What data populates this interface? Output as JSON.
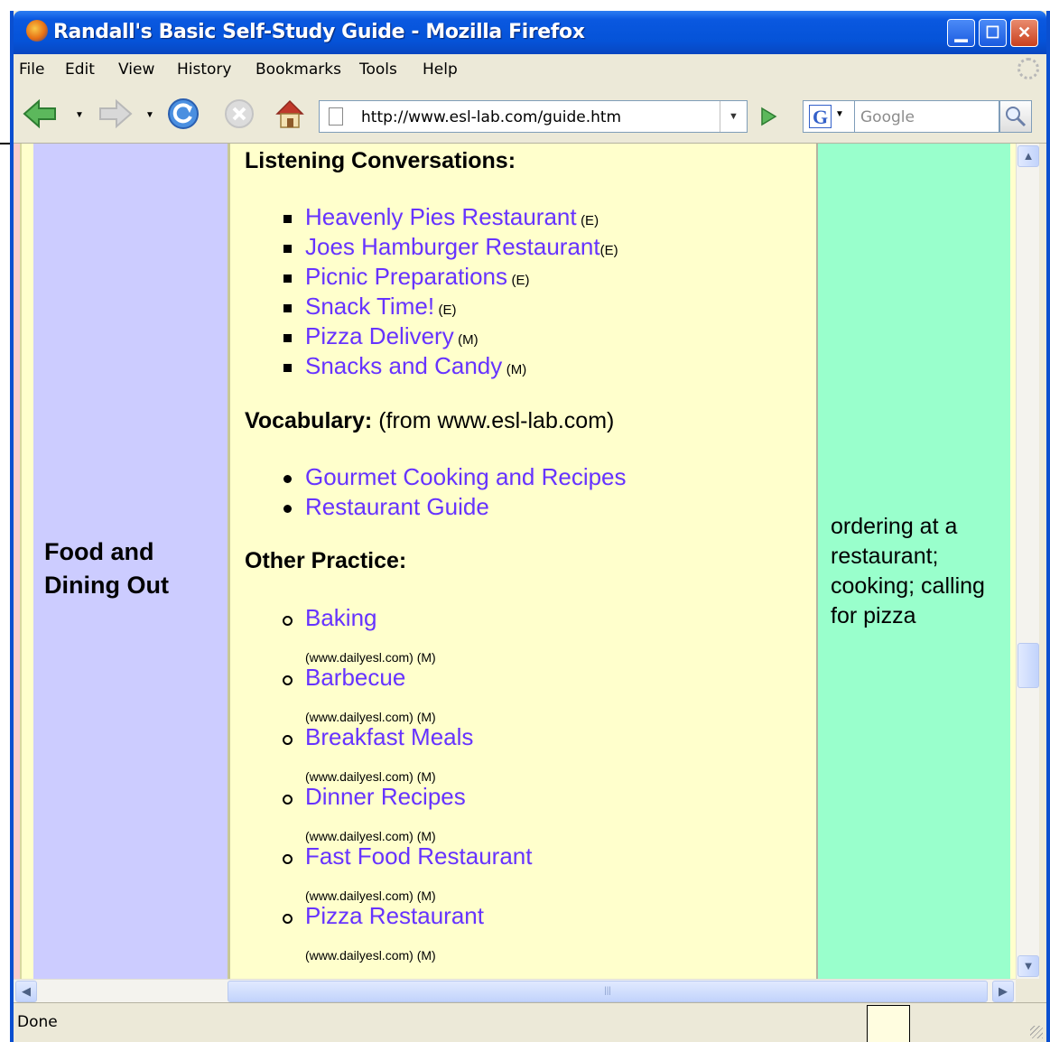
{
  "window": {
    "title": "Randall's Basic Self-Study Guide - Mozilla Firefox"
  },
  "menu": [
    "File",
    "Edit",
    "View",
    "History",
    "Bookmarks",
    "Tools",
    "Help"
  ],
  "toolbar": {
    "url": "http://www.esl-lab.com/guide.htm",
    "search_placeholder": "Google",
    "search_engine_letter": "G"
  },
  "page": {
    "topic": "Food and Dining Out",
    "listening": {
      "heading": "Listening Conversations:",
      "items": [
        {
          "label": "Heavenly Pies Restaurant",
          "level": "(E)"
        },
        {
          "label": "Joes Hamburger Restaurant",
          "level": "(E)"
        },
        {
          "label": "Picnic Preparations",
          "level": "(E)"
        },
        {
          "label": "Snack Time!",
          "level": "(E)"
        },
        {
          "label": "Pizza Delivery",
          "level": "(M)"
        },
        {
          "label": "Snacks and Candy",
          "level": "(M)"
        }
      ]
    },
    "vocabulary": {
      "heading": "Vocabulary:",
      "note": "(from www.esl-lab.com)",
      "items": [
        {
          "label": "Gourmet Cooking and Recipes"
        },
        {
          "label": "Restaurant Guide"
        }
      ]
    },
    "other": {
      "heading": "Other Practice:",
      "items": [
        {
          "label": "Baking",
          "source": "(www.dailyesl.com) (M)"
        },
        {
          "label": "Barbecue",
          "source": "(www.dailyesl.com) (M)"
        },
        {
          "label": "Breakfast Meals",
          "source": "(www.dailyesl.com) (M)"
        },
        {
          "label": "Dinner Recipes",
          "source": "(www.dailyesl.com) (M)"
        },
        {
          "label": "Fast Food Restaurant",
          "source": "(www.dailyesl.com) (M)"
        },
        {
          "label": "Pizza Restaurant",
          "source": "(www.dailyesl.com) (M)"
        }
      ]
    },
    "notes": "ordering at a restaurant; cooking; calling for pizza",
    "colors": {
      "topic_bg": "#ccccff",
      "main_bg": "#ffffcc",
      "notes_bg": "#99ffcc",
      "link": "#6633ff"
    }
  },
  "status": {
    "text": "Done"
  },
  "icons": [
    "firefox-icon",
    "back-icon",
    "forward-icon",
    "reload-icon",
    "stop-icon",
    "home-icon",
    "page-icon",
    "go-icon",
    "search-icon",
    "throbber-icon"
  ]
}
